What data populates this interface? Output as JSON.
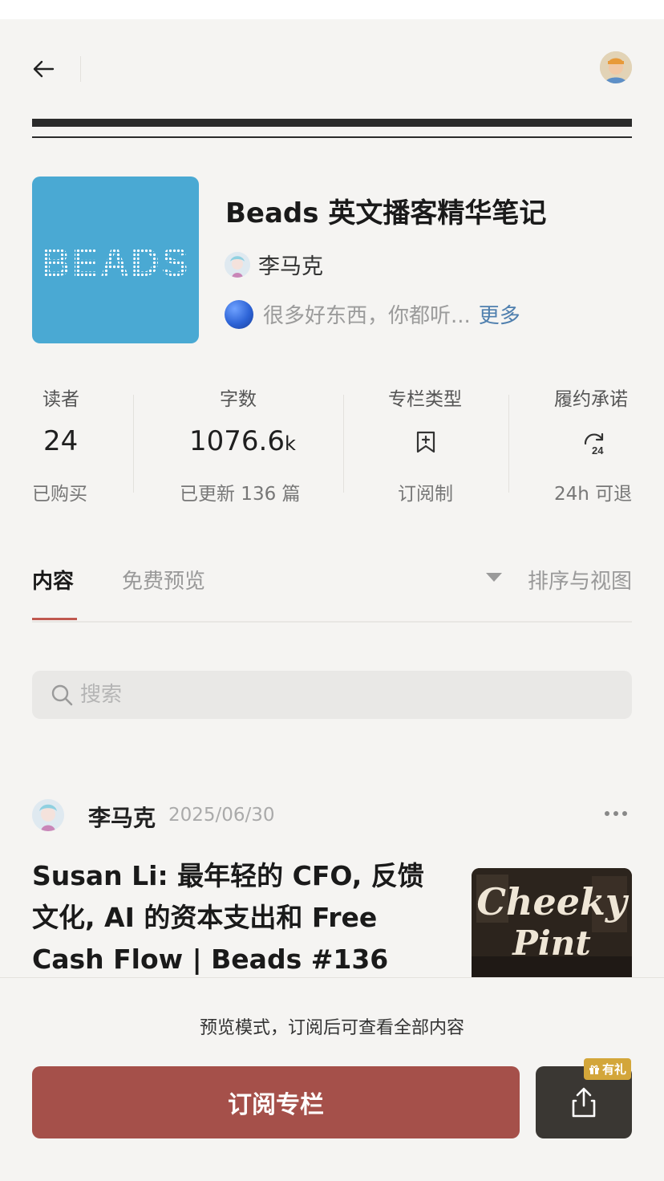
{
  "column": {
    "title": "Beads 英文播客精华笔记",
    "cover_text": "BEADS",
    "author": "李马克",
    "description": "很多好东西，你都听...",
    "more_label": "更多"
  },
  "stats": [
    {
      "label": "读者",
      "value": "24",
      "sub": "已购买"
    },
    {
      "label": "字数",
      "value": "1076.6",
      "value_unit": "k",
      "sub": "已更新 136 篇"
    },
    {
      "label": "专栏类型",
      "icon": "bookmark-plus-icon",
      "sub": "订阅制"
    },
    {
      "label": "履约承诺",
      "icon": "refund-24h-icon",
      "sub": "24h 可退"
    }
  ],
  "tabs": {
    "content": "内容",
    "free_preview": "免费预览",
    "sort_view": "排序与视图"
  },
  "search": {
    "placeholder": "搜索"
  },
  "post": {
    "author": "李马克",
    "date": "2025/06/30",
    "title": "Susan Li: 最年轻的 CFO, 反馈文化, AI 的资本支出和 Free Cash Flow | Beads #136",
    "thumb_text_1": "Cheeky",
    "thumb_text_2": "Pint"
  },
  "bottom": {
    "note": "预览模式，订阅后可查看全部内容",
    "subscribe_label": "订阅专栏",
    "gift_badge": "有礼"
  },
  "colors": {
    "accent": "#a5504a",
    "cover_bg": "#4aa9d3",
    "link": "#4f7fae",
    "badge": "#d3a63a"
  }
}
